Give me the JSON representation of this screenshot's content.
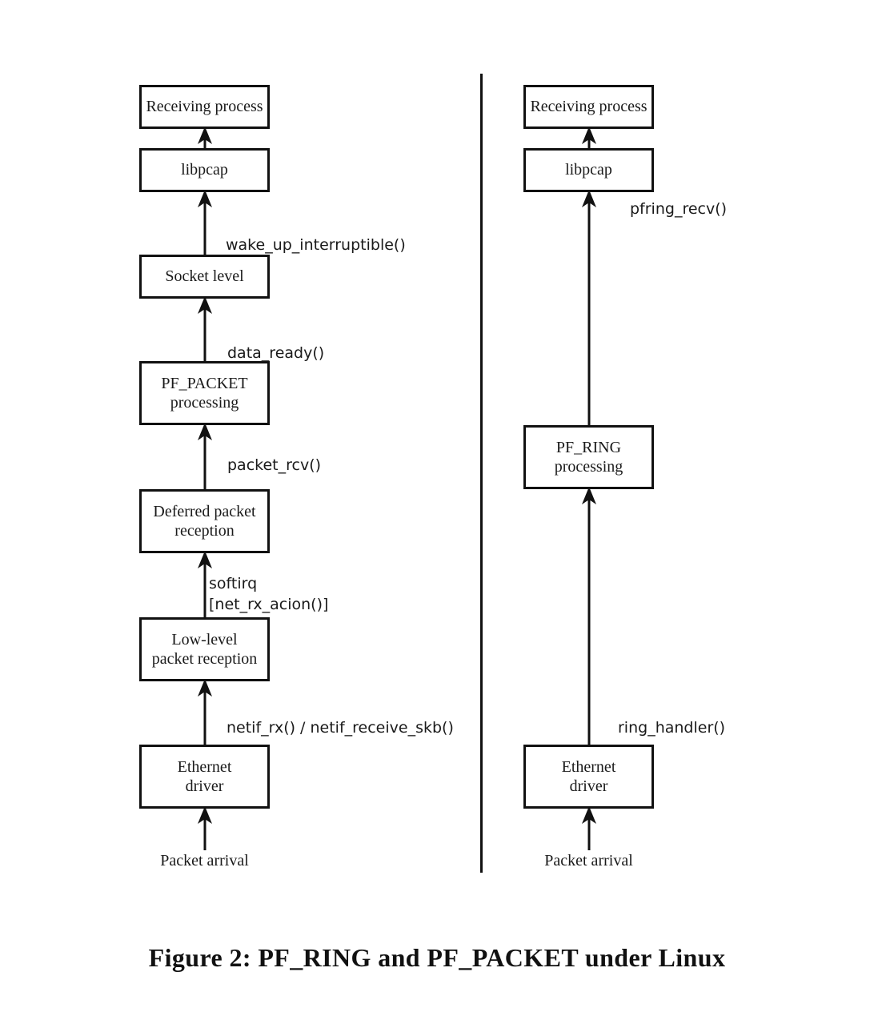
{
  "figure": {
    "caption": "Figure 2:  PF_RING and PF_PACKET under Linux",
    "divider_color": "#111111",
    "box_border_color": "#111111",
    "text_color": "#1a1a1a",
    "background": "#ffffff"
  },
  "chart_data": {
    "type": "diagram",
    "title": "Figure 2:  PF_RING and PF_PACKET under Linux",
    "description": "Two side-by-side vertical packet-reception flow stacks under Linux: the standard PF_PACKET path (left) and the PF_RING path (right). Arrows point upward from packet arrival to the receiving process; each arrow is annotated with the kernel/library function that performs the hand-off.",
    "columns": [
      {
        "name": "PF_PACKET",
        "nodes": [
          "Receiving process",
          "libpcap",
          "Socket level",
          "PF_PACKET processing",
          "Deferred packet reception",
          "Low-level packet reception",
          "Ethernet driver",
          "Packet arrival"
        ],
        "edges": [
          {
            "from": "libpcap",
            "to": "Receiving process",
            "label": ""
          },
          {
            "from": "Socket level",
            "to": "libpcap",
            "label": "wake_up_interruptible()"
          },
          {
            "from": "PF_PACKET processing",
            "to": "Socket level",
            "label": "data_ready()"
          },
          {
            "from": "Deferred packet reception",
            "to": "PF_PACKET processing",
            "label": "packet_rcv()"
          },
          {
            "from": "Low-level packet reception",
            "to": "Deferred packet reception",
            "label": "softirq [net_rx_acion()]"
          },
          {
            "from": "Ethernet driver",
            "to": "Low-level packet reception",
            "label": "netif_rx() / netif_receive_skb()"
          },
          {
            "from": "Packet arrival",
            "to": "Ethernet driver",
            "label": ""
          }
        ]
      },
      {
        "name": "PF_RING",
        "nodes": [
          "Receiving process",
          "libpcap",
          "PF_RING processing",
          "Ethernet driver",
          "Packet arrival"
        ],
        "edges": [
          {
            "from": "libpcap",
            "to": "Receiving process",
            "label": ""
          },
          {
            "from": "PF_RING processing",
            "to": "libpcap",
            "label": "pfring_recv()"
          },
          {
            "from": "Ethernet driver",
            "to": "PF_RING processing",
            "label": "ring_handler()"
          },
          {
            "from": "Packet arrival",
            "to": "Ethernet driver",
            "label": ""
          }
        ]
      }
    ]
  },
  "left_column": {
    "nodes": {
      "receiving_process": "Receiving process",
      "libpcap": "libpcap",
      "socket_level": "Socket level",
      "pf_packet_line1": "PF_PACKET",
      "pf_packet_line2": "processing",
      "deferred_line1": "Deferred packet",
      "deferred_line2": "reception",
      "lowlevel_line1": "Low-level",
      "lowlevel_line2": "packet reception",
      "ethernet_line1": "Ethernet",
      "ethernet_line2": "driver",
      "packet_arrival": "Packet arrival"
    },
    "labels": {
      "wake_up": "wake_up_interruptible()",
      "data_ready": "data_ready()",
      "packet_rcv": "packet_rcv()",
      "softirq_line1": "softirq",
      "softirq_line2": "[net_rx_acion()]",
      "netif": "netif_rx() / netif_receive_skb()"
    }
  },
  "right_column": {
    "nodes": {
      "receiving_process": "Receiving process",
      "libpcap": "libpcap",
      "pf_ring_line1": "PF_RING",
      "pf_ring_line2": "processing",
      "ethernet_line1": "Ethernet",
      "ethernet_line2": "driver",
      "packet_arrival": "Packet arrival"
    },
    "labels": {
      "pfring_recv": "pfring_recv()",
      "ring_handler": "ring_handler()"
    }
  }
}
